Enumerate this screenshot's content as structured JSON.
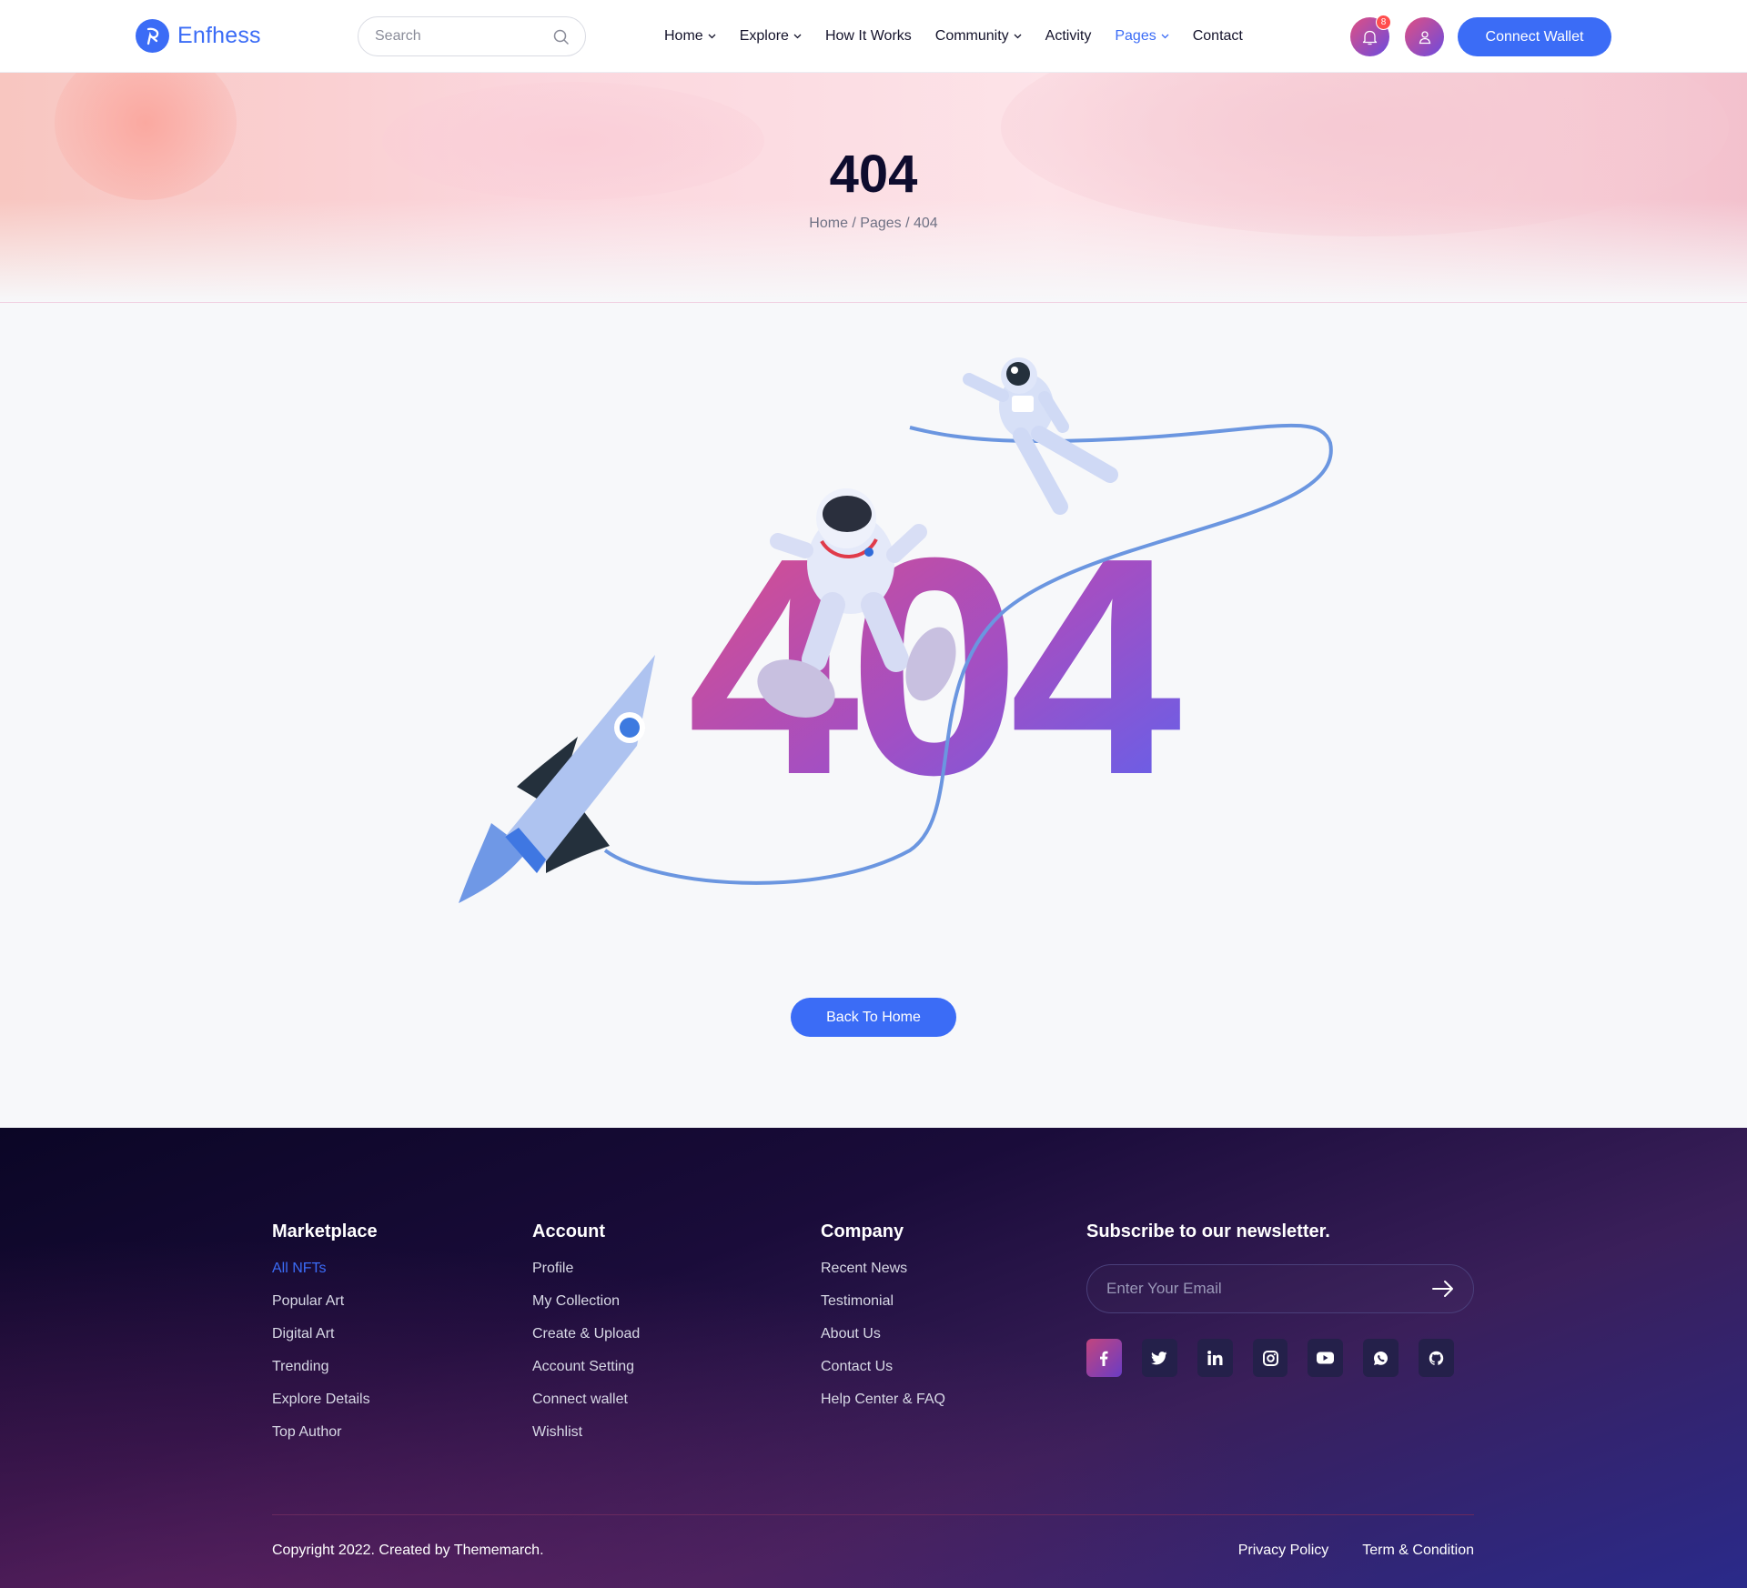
{
  "brand": {
    "name": "Enfhess",
    "accent": "#3b6cf6"
  },
  "search": {
    "placeholder": "Search"
  },
  "nav": [
    {
      "label": "Home",
      "has_dropdown": true,
      "active": false
    },
    {
      "label": "Explore",
      "has_dropdown": true,
      "active": false
    },
    {
      "label": "How It Works",
      "has_dropdown": false,
      "active": false
    },
    {
      "label": "Community",
      "has_dropdown": true,
      "active": false
    },
    {
      "label": "Activity",
      "has_dropdown": false,
      "active": false
    },
    {
      "label": "Pages",
      "has_dropdown": true,
      "active": true
    },
    {
      "label": "Contact",
      "has_dropdown": false,
      "active": false
    }
  ],
  "header_actions": {
    "notification_count": "8",
    "connect_label": "Connect Wallet"
  },
  "hero": {
    "title": "404",
    "breadcrumb": "Home / Pages / 404"
  },
  "error": {
    "code": "404",
    "back_label": "Back To Home"
  },
  "footer": {
    "marketplace": {
      "title": "Marketplace",
      "links": [
        "All NFTs",
        "Popular Art",
        "Digital Art",
        "Trending",
        "Explore Details",
        "Top Author"
      ]
    },
    "account": {
      "title": "Account",
      "links": [
        "Profile",
        "My Collection",
        "Create & Upload",
        "Account Setting",
        "Connect wallet",
        "Wishlist"
      ]
    },
    "company": {
      "title": "Company",
      "links": [
        "Recent News",
        "Testimonial",
        "About Us",
        "Contact Us",
        "Help Center & FAQ"
      ]
    },
    "newsletter": {
      "title": "Subscribe to our newsletter.",
      "placeholder": "Enter Your Email"
    },
    "socials": [
      "facebook-icon",
      "twitter-icon",
      "linkedin-icon",
      "instagram-icon",
      "youtube-icon",
      "whatsapp-icon",
      "github-icon"
    ],
    "copyright": "Copyright 2022. Created by Thememarch.",
    "legal": [
      "Privacy Policy",
      "Term & Condition"
    ]
  }
}
